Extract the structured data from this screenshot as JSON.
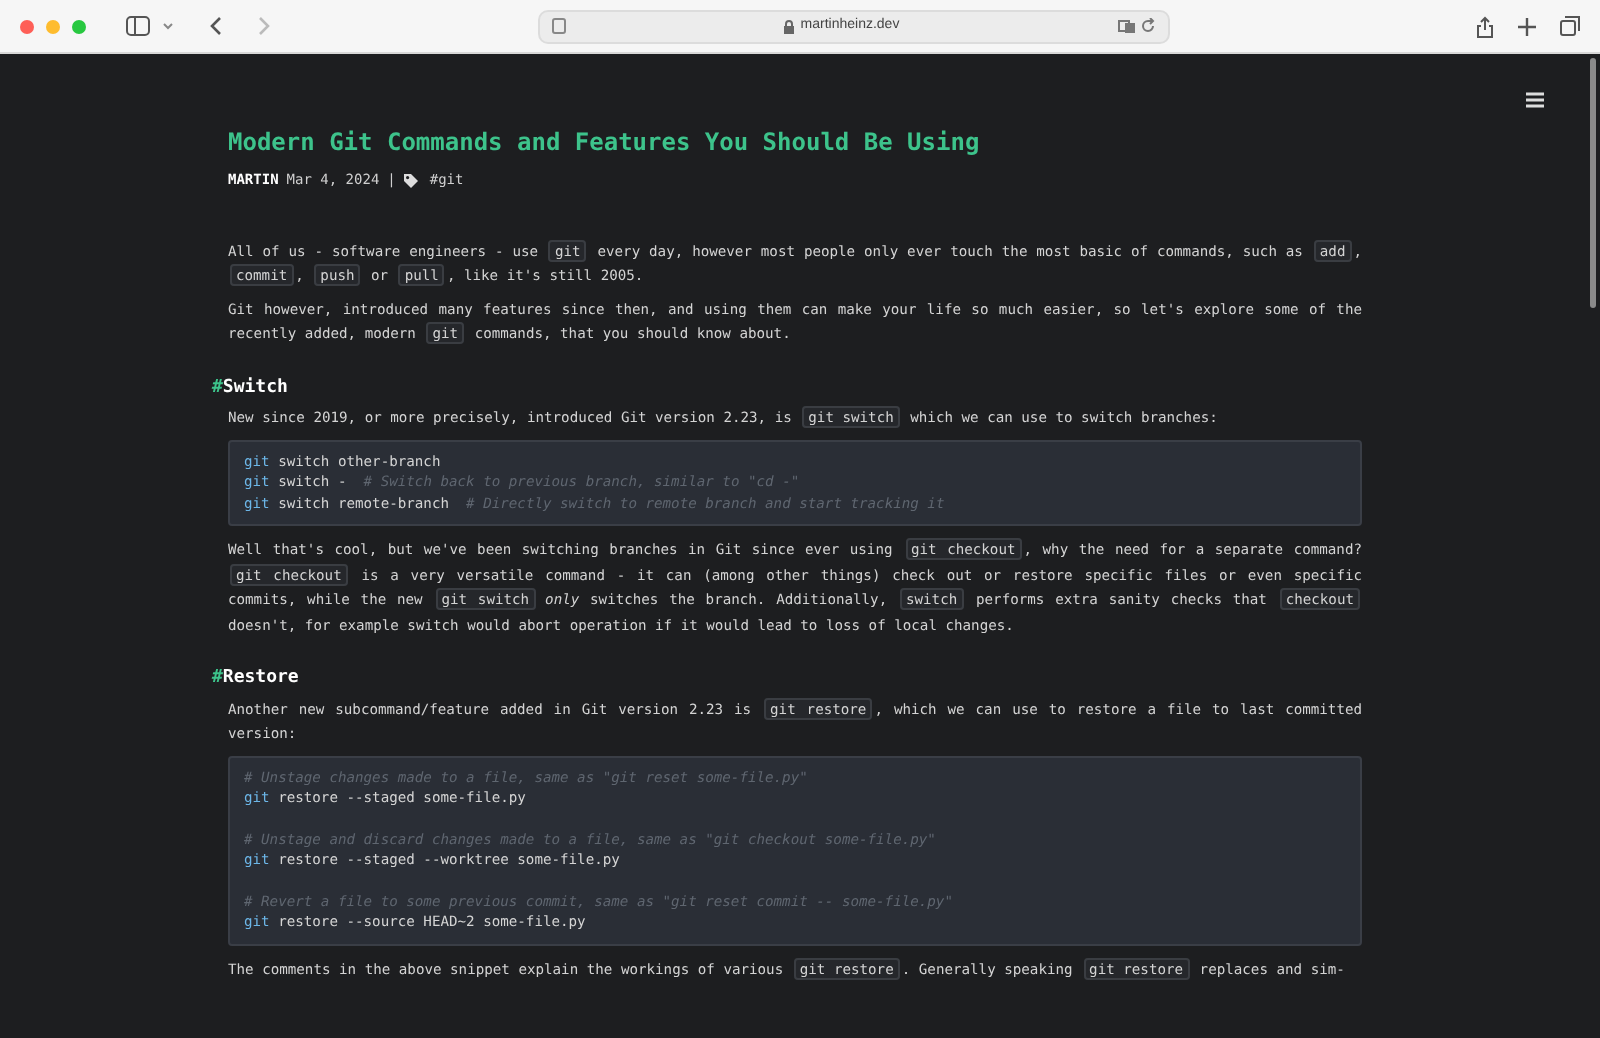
{
  "browser": {
    "url": "martinheinz.dev"
  },
  "article": {
    "title": "Modern Git Commands and Features You Should Be Using",
    "author": "MARTIN",
    "date": "Mar 4, 2024",
    "separator": "|",
    "tag": "#git",
    "blocks": [
      {
        "kind": "para",
        "parts": [
          {
            "kind": "text",
            "text": "All of us - software engineers - use "
          },
          {
            "kind": "code",
            "text": "git"
          },
          {
            "kind": "text",
            "text": " every day, however most people only ever touch the most basic of commands, such as "
          },
          {
            "kind": "code",
            "text": "add"
          },
          {
            "kind": "text",
            "text": ", "
          },
          {
            "kind": "code",
            "text": "commit"
          },
          {
            "kind": "text",
            "text": ", "
          },
          {
            "kind": "code",
            "text": "push"
          },
          {
            "kind": "text",
            "text": " or "
          },
          {
            "kind": "code",
            "text": "pull"
          },
          {
            "kind": "text",
            "text": ", like it's still 2005."
          }
        ]
      },
      {
        "kind": "para",
        "parts": [
          {
            "kind": "text",
            "text": "Git however, introduced many features since then, and using them can make your life so much easier, so let's explore some of the recently added, modern "
          },
          {
            "kind": "code",
            "text": "git"
          },
          {
            "kind": "text",
            "text": " commands, that you should know about."
          }
        ]
      },
      {
        "kind": "heading",
        "mark": "#",
        "text": "Switch"
      },
      {
        "kind": "para",
        "parts": [
          {
            "kind": "text",
            "text": "New since 2019, or more precisely, introduced Git version 2.23, is "
          },
          {
            "kind": "code",
            "text": "git switch"
          },
          {
            "kind": "text",
            "text": " which we can use to switch branches:"
          }
        ]
      },
      {
        "kind": "codeblock",
        "groups": [
          [
            [
              {
                "kind": "cmd",
                "text": "git"
              },
              {
                "kind": "text",
                "text": " switch other-branch"
              }
            ],
            [
              {
                "kind": "cmd",
                "text": "git"
              },
              {
                "kind": "text",
                "text": " switch -  "
              },
              {
                "kind": "comment",
                "text": "# Switch back to previous branch, similar to \"cd -\""
              }
            ],
            [
              {
                "kind": "cmd",
                "text": "git"
              },
              {
                "kind": "text",
                "text": " switch remote-branch  "
              },
              {
                "kind": "comment",
                "text": "# Directly switch to remote branch and start tracking it"
              }
            ]
          ]
        ]
      },
      {
        "kind": "para",
        "parts": [
          {
            "kind": "text",
            "text": "Well that's cool, but we've been switching branches in Git since ever using "
          },
          {
            "kind": "code",
            "text": "git checkout"
          },
          {
            "kind": "text",
            "text": ", why the need for a separate command? "
          },
          {
            "kind": "code",
            "text": "git checkout"
          },
          {
            "kind": "text",
            "text": " is a very versatile command - it can (among other things) check out or restore specific files or even specific commits, while the new "
          },
          {
            "kind": "code",
            "text": "git switch"
          },
          {
            "kind": "em",
            "text": "only"
          },
          {
            "kind": "text",
            "text": " switches the branch. Additionally, "
          },
          {
            "kind": "code",
            "text": "switch"
          },
          {
            "kind": "text",
            "text": " performs extra sanity checks that "
          },
          {
            "kind": "code",
            "text": "checkout"
          },
          {
            "kind": "text",
            "text": " doesn't, for example switch would abort operation if it would lead to loss of local changes."
          }
        ]
      },
      {
        "kind": "heading",
        "mark": "#",
        "text": "Restore"
      },
      {
        "kind": "para",
        "parts": [
          {
            "kind": "text",
            "text": "Another new subcommand/feature added in Git version 2.23 is "
          },
          {
            "kind": "code",
            "text": "git restore"
          },
          {
            "kind": "text",
            "text": ", which we can use to restore a file to last committed version:"
          }
        ]
      },
      {
        "kind": "codeblock",
        "groups": [
          [
            [
              {
                "kind": "comment",
                "text": "# Unstage changes made to a file, same as \"git reset some-file.py\""
              }
            ],
            [
              {
                "kind": "cmd",
                "text": "git"
              },
              {
                "kind": "text",
                "text": " restore --staged some-file.py"
              }
            ]
          ],
          [
            [
              {
                "kind": "comment",
                "text": "# Unstage and discard changes made to a file, same as \"git checkout some-file.py\""
              }
            ],
            [
              {
                "kind": "cmd",
                "text": "git"
              },
              {
                "kind": "text",
                "text": " restore --staged --worktree some-file.py"
              }
            ]
          ],
          [
            [
              {
                "kind": "comment",
                "text": "# Revert a file to some previous commit, same as \"git reset commit -- some-file.py\""
              }
            ],
            [
              {
                "kind": "cmd",
                "text": "git"
              },
              {
                "kind": "text",
                "text": " restore --source HEAD~2 some-file.py"
              }
            ]
          ]
        ]
      },
      {
        "kind": "para",
        "parts": [
          {
            "kind": "text",
            "text": "The comments in the above snippet explain the workings of various "
          },
          {
            "kind": "code",
            "text": "git restore"
          },
          {
            "kind": "text",
            "text": ". Generally speaking "
          },
          {
            "kind": "code",
            "text": "git restore"
          },
          {
            "kind": "text",
            "text": " replaces and sim-"
          }
        ]
      }
    ]
  }
}
